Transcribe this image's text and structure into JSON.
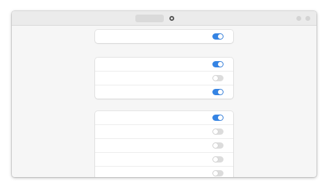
{
  "header": {
    "title": "",
    "subtitle": ""
  },
  "colors": {
    "accent": "#3584e4",
    "switch_off": "#dcdcdc",
    "card": "#ffffff",
    "window": "#f6f6f6"
  },
  "groups": [
    {
      "rows": [
        {
          "label": "",
          "on": true
        }
      ]
    },
    {
      "rows": [
        {
          "label": "",
          "on": true
        },
        {
          "label": "",
          "on": false
        },
        {
          "label": "",
          "on": true
        }
      ]
    },
    {
      "rows": [
        {
          "label": "",
          "on": true
        },
        {
          "label": "",
          "on": false
        },
        {
          "label": "",
          "on": false
        },
        {
          "label": "",
          "on": false
        },
        {
          "label": "",
          "on": false
        }
      ]
    }
  ]
}
